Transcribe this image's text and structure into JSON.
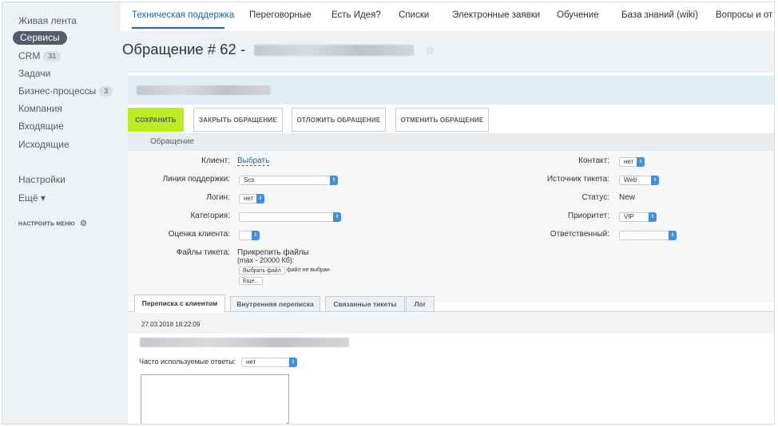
{
  "sidebar": {
    "items": [
      {
        "label": "Живая лента"
      },
      {
        "label": "Сервисы",
        "active": true
      },
      {
        "label": "CRM",
        "badge": "31"
      },
      {
        "label": "Задачи"
      },
      {
        "label": "Бизнес-процессы",
        "badge": "3"
      },
      {
        "label": "Компания"
      },
      {
        "label": "Входящие"
      },
      {
        "label": "Исходящие"
      },
      {
        "label": "Настройки"
      },
      {
        "label": "Ещё ▾"
      }
    ],
    "configure_label": "НАСТРОИТЬ МЕНЮ"
  },
  "topnav": {
    "tabs": [
      "Техническая поддержка",
      "Переговорные",
      "Есть Идея?",
      "Списки",
      "Электронные заявки",
      "Обучение",
      "База знаний (wiki)",
      "Вопросы и от"
    ]
  },
  "page": {
    "title_prefix": "Обращение # 62 -"
  },
  "actions": {
    "save": "Сохранить",
    "close": "Закрыть обращение",
    "postpone": "Отложить обращение",
    "cancel": "Отменить обращение"
  },
  "section_title": "Обращение",
  "form": {
    "client_label": "Клиент:",
    "client_link": "Выбрать",
    "line_label": "Линия поддержки:",
    "line_value": "Scs",
    "login_label": "Логин:",
    "login_value": "нет",
    "category_label": "Категория:",
    "category_value": "",
    "rating_label": "Оценка клиента:",
    "rating_value": "",
    "files_label": "Файлы тикета:",
    "attach_title": "Прикрепить файлы",
    "attach_limit": "(max - 20000 Кб):",
    "choose_file": "Выбрать файл",
    "no_file": "файл не выбран",
    "more": "Еще...",
    "contact_label": "Контакт:",
    "contact_value": "нет",
    "source_label": "Источник тикета:",
    "source_value": "Web",
    "status_label": "Статус:",
    "status_value": "New",
    "priority_label": "Приоритет:",
    "priority_value": "VIP",
    "responsible_label": "Ответственный:",
    "responsible_value": ""
  },
  "tabs2": [
    "Переписка с клиентом",
    "Внутренняя переписка",
    "Связанные тикеты",
    "Лог"
  ],
  "correspondence": {
    "timestamp": "27.03.2018 18:22:09",
    "faq_label": "Часто используемые ответы:",
    "faq_value": "нет"
  }
}
